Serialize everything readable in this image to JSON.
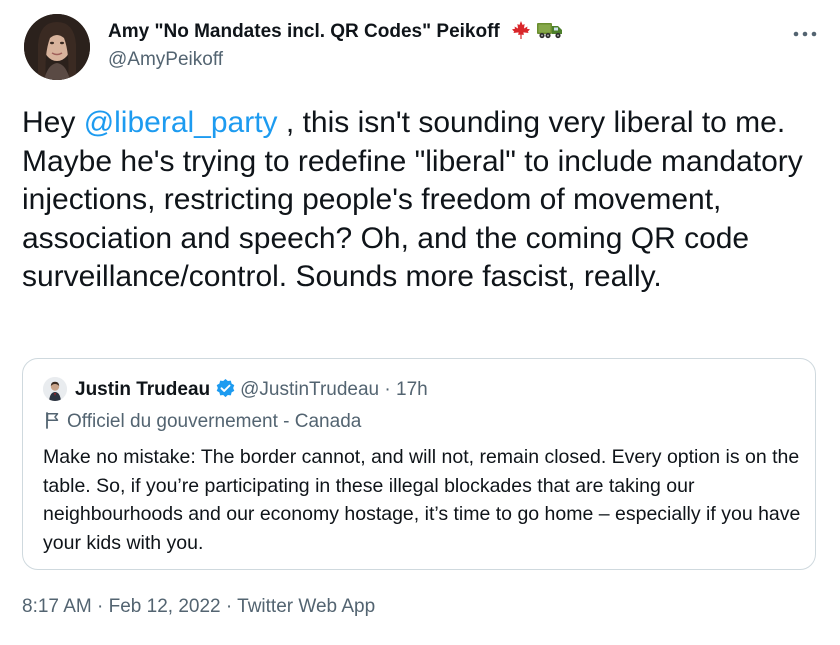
{
  "tweet": {
    "author": {
      "name": "Amy \"No Mandates incl. QR Codes\" Peikoff",
      "handle": "@AmyPeikoff",
      "flag_icons": [
        "maple-leaf-icon",
        "truck-icon"
      ]
    },
    "more_icon": "more-options-icon",
    "text": {
      "part1": "Hey ",
      "mention": "@liberal_party",
      "part2": " , this isn't sounding very liberal to me. Maybe he's trying to redefine \"liberal\" to include mandatory injections, restricting people's freedom of movement, association and speech? Oh, and the coming QR code surveillance/control. Sounds more fascist, really."
    },
    "timestamp": {
      "time": "8:17 AM",
      "sep1": " · ",
      "date": "Feb 12, 2022",
      "sep2": " · ",
      "source": "Twitter Web App"
    }
  },
  "quoted_tweet": {
    "name": "Justin Trudeau",
    "verified": true,
    "handle": "@JustinTrudeau",
    "dot": " · ",
    "time": "17h",
    "label": "Officiel du gouvernement - Canada",
    "text": "Make no mistake: The border cannot, and will not, remain closed. Every option is on the table. So, if you’re participating in these illegal blockades that are taking our neighbourhoods and our economy hostage, it’s time to go home – especially if you have your kids with you."
  },
  "colors": {
    "link": "#1d9bf0",
    "secondary_text": "#536471",
    "primary_text": "#0f1419",
    "border": "#cfd9de"
  }
}
